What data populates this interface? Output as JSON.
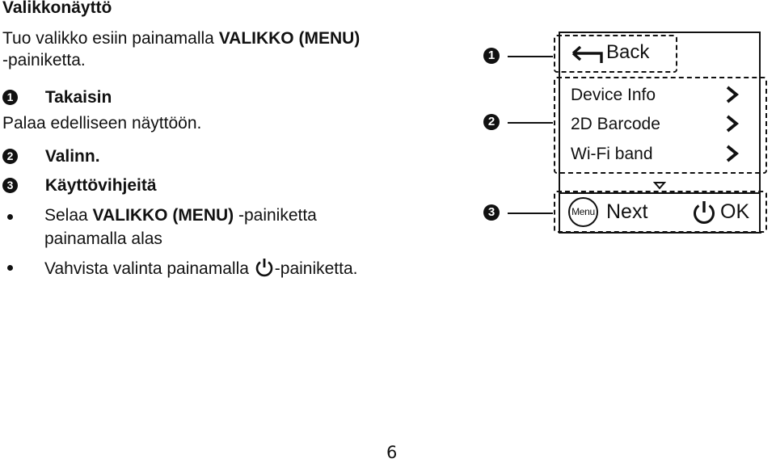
{
  "heading": "Valikkonäyttö",
  "intro": {
    "prefix": "Tuo valikko esiin painamalla ",
    "button_name": "VALIKKO (MENU)",
    "suffix": "-painiketta."
  },
  "sections": [
    {
      "number": "1",
      "title": "Takaisin",
      "description": "Palaa edelliseen näyttöön."
    },
    {
      "number": "2",
      "title": "Valinn."
    },
    {
      "number": "3",
      "title": "Käyttövihjeitä"
    }
  ],
  "tips": [
    {
      "line1_prefix": "Selaa ",
      "line1_bold": "VALIKKO (MENU)",
      "line1_suffix": " -painiketta",
      "line2": "painamalla alas"
    },
    {
      "prefix": "Vahvista valinta painamalla ",
      "icon": "power-icon",
      "suffix": "-painiketta."
    }
  ],
  "diagram": {
    "callouts": [
      "1",
      "2",
      "3"
    ],
    "back_label": "Back",
    "menu_items": [
      {
        "label": "Device Info",
        "icon": "chevron-right-icon"
      },
      {
        "label": "2D Barcode",
        "icon": "chevron-right-icon"
      },
      {
        "label": "Wi-Fi band",
        "icon": "chevron-right-icon"
      }
    ],
    "scroll_indicator": "down-triangle-icon",
    "footer": {
      "menu_button_label": "Menu",
      "next_label": "Next",
      "ok_label": "OK"
    }
  },
  "page_number": "6"
}
